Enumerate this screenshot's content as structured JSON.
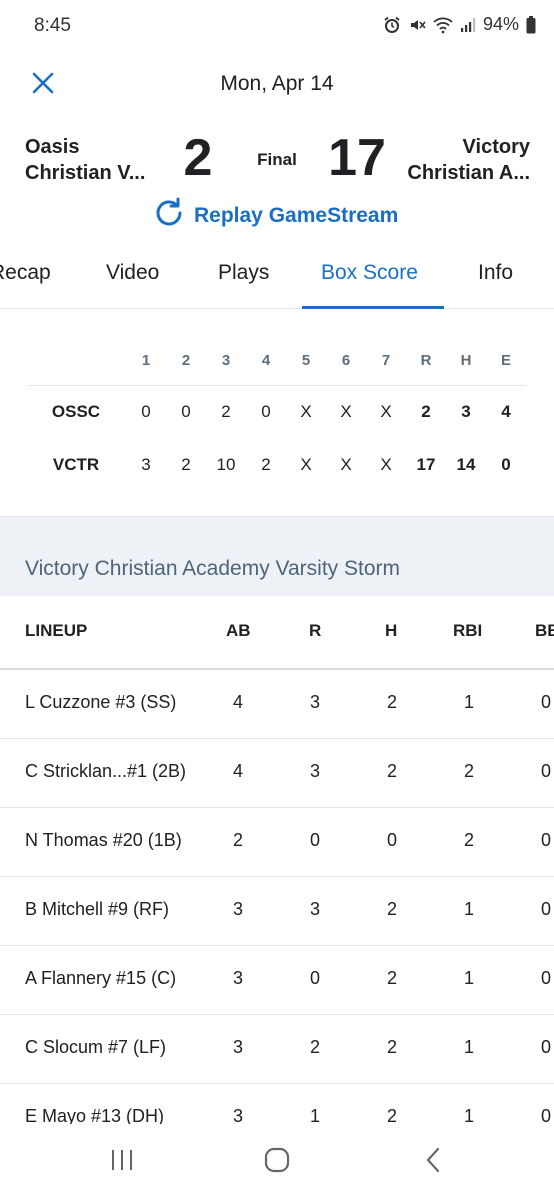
{
  "status_bar": {
    "time": "8:45",
    "battery": "94%"
  },
  "header": {
    "date": "Mon, Apr 14"
  },
  "game": {
    "home_team_line1": "Oasis",
    "home_team_line2": "Christian V...",
    "away_team_line1": "Victory",
    "away_team_line2": "Christian A...",
    "home_score": "2",
    "away_score": "17",
    "status": "Final",
    "replay_label": "Replay GameStream"
  },
  "tabs": [
    {
      "label": "Recap"
    },
    {
      "label": "Video"
    },
    {
      "label": "Plays"
    },
    {
      "label": "Box Score",
      "active": true
    },
    {
      "label": "Info"
    }
  ],
  "linescore": {
    "headers": [
      "1",
      "2",
      "3",
      "4",
      "5",
      "6",
      "7",
      "R",
      "H",
      "E"
    ],
    "rows": [
      {
        "team": "OSSC",
        "values": [
          "0",
          "0",
          "2",
          "0",
          "X",
          "X",
          "X",
          "2",
          "3",
          "4"
        ]
      },
      {
        "team": "VCTR",
        "values": [
          "3",
          "2",
          "10",
          "2",
          "X",
          "X",
          "X",
          "17",
          "14",
          "0"
        ]
      }
    ]
  },
  "team_section": {
    "title": "Victory Christian Academy Varsity Storm"
  },
  "lineup": {
    "headers": [
      "LINEUP",
      "AB",
      "R",
      "H",
      "RBI",
      "BB"
    ],
    "rows": [
      {
        "name": "L Cuzzone #3 (SS)",
        "ab": "4",
        "r": "3",
        "h": "2",
        "rbi": "1",
        "bb": "0"
      },
      {
        "name": "C Stricklan...#1 (2B)",
        "ab": "4",
        "r": "3",
        "h": "2",
        "rbi": "2",
        "bb": "0"
      },
      {
        "name": "N Thomas #20 (1B)",
        "ab": "2",
        "r": "0",
        "h": "0",
        "rbi": "2",
        "bb": "0"
      },
      {
        "name": "B Mitchell #9 (RF)",
        "ab": "3",
        "r": "3",
        "h": "2",
        "rbi": "1",
        "bb": "0"
      },
      {
        "name": "A Flannery #15 (C)",
        "ab": "3",
        "r": "0",
        "h": "2",
        "rbi": "1",
        "bb": "0"
      },
      {
        "name": "C Slocum #7 (LF)",
        "ab": "3",
        "r": "2",
        "h": "2",
        "rbi": "1",
        "bb": "0"
      },
      {
        "name": "E Mayo #13 (DH)",
        "ab": "3",
        "r": "1",
        "h": "2",
        "rbi": "1",
        "bb": "0"
      }
    ]
  },
  "icons": {
    "close": "close-icon",
    "replay": "refresh-icon",
    "nav_recent": "recent-apps-icon",
    "nav_home": "home-icon",
    "nav_back": "back-icon"
  },
  "colors": {
    "accent": "#1a6fc4",
    "band": "#eef2f7",
    "muted": "#5d6e7e"
  }
}
